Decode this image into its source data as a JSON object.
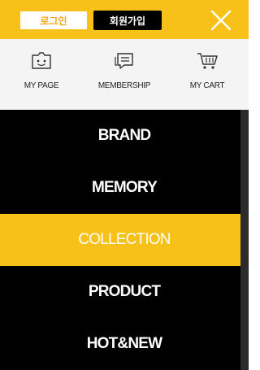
{
  "header": {
    "login_label": "로그인",
    "join_label": "회원가입"
  },
  "quick_links": [
    {
      "label": "MY PAGE",
      "icon": "profile-card-icon"
    },
    {
      "label": "MEMBERSHIP",
      "icon": "chat-list-icon"
    },
    {
      "label": "MY CART",
      "icon": "cart-icon"
    }
  ],
  "menu": [
    {
      "label": "BRAND"
    },
    {
      "label": "MEMORY"
    },
    {
      "label": "COLLECTION",
      "active": true
    },
    {
      "label": "PRODUCT"
    },
    {
      "label": "HOT&NEW"
    }
  ],
  "colors": {
    "accent_yellow": "#f7c11a",
    "menu_bg": "#000000",
    "quick_bg": "#f4f4f4"
  }
}
